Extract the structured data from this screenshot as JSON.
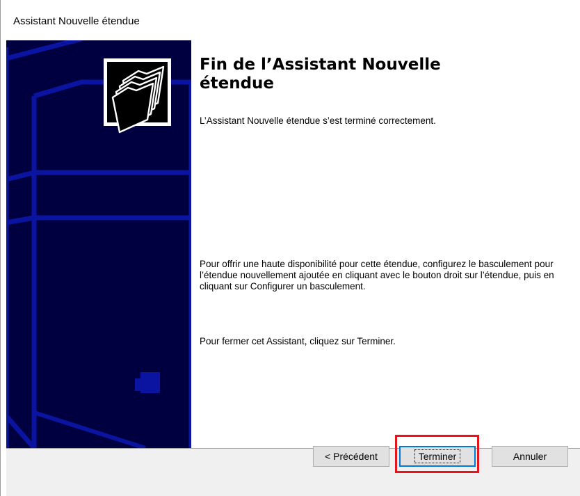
{
  "window": {
    "title": "Assistant Nouvelle étendue"
  },
  "banner": {
    "icon": "folders-icon",
    "background_color": "#000040",
    "line_color": "#0a14a0"
  },
  "content": {
    "heading": "Fin de l’Assistant Nouvelle étendue",
    "status_line": "L’Assistant Nouvelle étendue s’est terminé correctement.",
    "failover_paragraph": "Pour offrir une haute disponibilité pour cette étendue, configurez le basculement pour l’étendue nouvellement ajoutée en cliquant avec le bouton droit sur l’étendue, puis en cliquant sur Configurer un basculement.",
    "close_instruction": "Pour fermer cet Assistant, cliquez sur Terminer."
  },
  "buttons": {
    "back_label": "< Précédent",
    "finish_label": "Terminer",
    "cancel_label": "Annuler"
  },
  "annotation": {
    "highlight_color": "#e8141c",
    "target": "finish-button"
  }
}
